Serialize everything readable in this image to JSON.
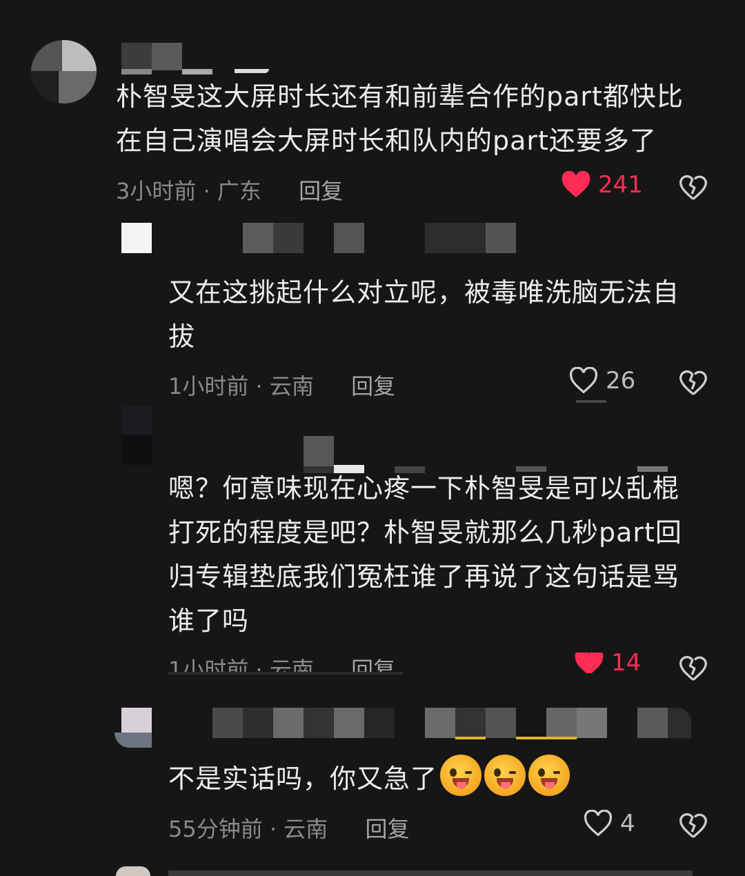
{
  "comments": [
    {
      "text_lines": [
        "朴智旻这大屏时长还有和前辈合作的part都快比",
        "在自己演唱会大屏时长和队内的part还要多了"
      ],
      "time": "3小时前",
      "location": "广东",
      "reply_label": "回复",
      "likes": "241",
      "liked": true
    },
    {
      "text_lines": [
        "又在这挑起什么对立呢，被毒唯洗脑无法自",
        "拔"
      ],
      "time": "1小时前",
      "location": "云南",
      "reply_label": "回复",
      "likes": "26",
      "liked": false
    },
    {
      "text_lines": [
        "嗯？何意味现在心疼一下朴智旻是可以乱棍",
        "打死的程度是吧？朴智旻就那么几秒part回",
        "归专辑垫底我们冤枉谁了再说了这句话是骂",
        "谁了吗"
      ],
      "time": "1小时前",
      "location": "云南",
      "reply_label": "回复",
      "likes": "14",
      "liked": true
    },
    {
      "text_lines": [
        "不是实话吗，你又急了"
      ],
      "emojis": [
        "tongue-wink-emoji",
        "tongue-wink-emoji",
        "tongue-wink-emoji"
      ],
      "time": "55分钟前",
      "location": "云南",
      "reply_label": "回复",
      "likes": "4",
      "liked": false
    }
  ],
  "separator": "·",
  "colors": {
    "liked": "#fe2c55",
    "background": "#161616",
    "meta": "#8a8a8a"
  },
  "icons": {
    "like": "heart-icon",
    "dislike": "broken-heart-icon"
  }
}
